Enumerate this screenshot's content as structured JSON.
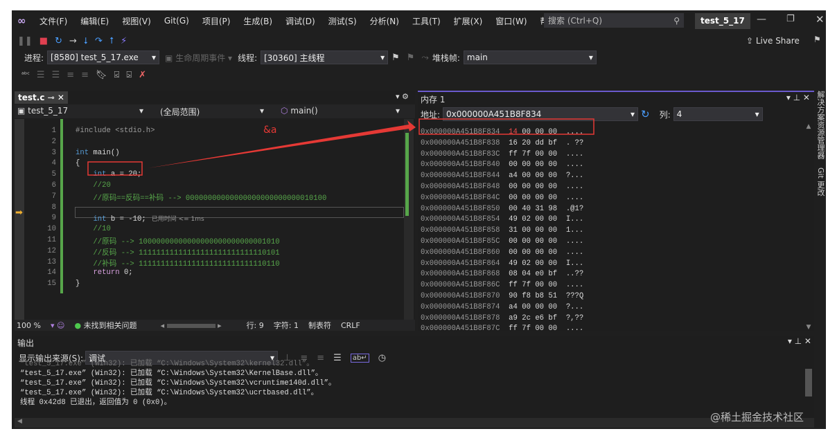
{
  "menu": {
    "items": [
      "文件(F)",
      "编辑(E)",
      "视图(V)",
      "Git(G)",
      "项目(P)",
      "生成(B)",
      "调试(D)",
      "测试(S)",
      "分析(N)",
      "工具(T)",
      "扩展(X)",
      "窗口(W)",
      "帮助(H)"
    ],
    "search_placeholder": "搜索 (Ctrl+Q)",
    "solution": "test_5_17",
    "live_share": "Live Share"
  },
  "debug_toolbar": {
    "process_label": "进程:",
    "process": "[8580] test_5_17.exe",
    "lifecycle": "生命周期事件",
    "thread_label": "线程:",
    "thread": "[30360] 主线程",
    "stack_label": "堆栈帧:",
    "stack": "main"
  },
  "editor": {
    "tab": "test.c",
    "project": "test_5_17",
    "scope": "(全局范围)",
    "function": "main()",
    "lines": [
      [
        {
          "t": "#include <stdio.h>",
          "c": "pp"
        }
      ],
      [],
      [
        {
          "t": "int",
          "c": "kw"
        },
        {
          "t": " main()",
          "c": "tx"
        }
      ],
      [
        {
          "t": "{",
          "c": "tx"
        }
      ],
      [
        {
          "t": "    "
        },
        {
          "t": "int",
          "c": "kw"
        },
        {
          "t": " a = 20;",
          "c": "tx"
        }
      ],
      [
        {
          "t": "    //20",
          "c": "cm"
        }
      ],
      [
        {
          "t": "    //原码==反码==补码 --> 00000000000000000000000000010100",
          "c": "cm"
        }
      ],
      [],
      [
        {
          "t": "    "
        },
        {
          "t": "int",
          "c": "kw"
        },
        {
          "t": " b = -10;",
          "c": "tx"
        }
      ],
      [
        {
          "t": "    //10",
          "c": "cm"
        }
      ],
      [
        {
          "t": "    //原码 --> 10000000000000000000000000001010",
          "c": "cm"
        }
      ],
      [
        {
          "t": "    //反码 --> 11111111111111111111111111110101",
          "c": "cm"
        }
      ],
      [
        {
          "t": "    //补码 --> 11111111111111111111111111110110",
          "c": "cm"
        }
      ],
      [
        {
          "t": "    "
        },
        {
          "t": "return",
          "c": "kw2"
        },
        {
          "t": " 0;",
          "c": "tx"
        }
      ],
      [
        {
          "t": "}",
          "c": "tx"
        }
      ]
    ],
    "elapsed": "已用时间 <= 1ms",
    "current_line": 9,
    "status": {
      "zoom": "100 %",
      "issues": "未找到相关问题",
      "line": "行: 9",
      "char": "字符: 1",
      "tabs": "制表符",
      "eol": "CRLF"
    }
  },
  "annotation": {
    "label": "&a",
    "color": "#e53935"
  },
  "memory": {
    "title": "内存 1",
    "address_label": "地址:",
    "address": "0x000000A451B8F834",
    "columns_label": "列:",
    "columns": "4",
    "rows": [
      {
        "addr": "0x000000A451B8F834",
        "bytes": [
          "14",
          "00",
          "00",
          "00"
        ],
        "ascii": "...."
      },
      {
        "addr": "0x000000A451B8F838",
        "bytes": [
          "16",
          "20",
          "dd",
          "bf"
        ],
        "ascii": ". ??"
      },
      {
        "addr": "0x000000A451B8F83C",
        "bytes": [
          "ff",
          "7f",
          "00",
          "00"
        ],
        "ascii": "...."
      },
      {
        "addr": "0x000000A451B8F840",
        "bytes": [
          "00",
          "00",
          "00",
          "00"
        ],
        "ascii": "...."
      },
      {
        "addr": "0x000000A451B8F844",
        "bytes": [
          "a4",
          "00",
          "00",
          "00"
        ],
        "ascii": "?..."
      },
      {
        "addr": "0x000000A451B8F848",
        "bytes": [
          "00",
          "00",
          "00",
          "00"
        ],
        "ascii": "...."
      },
      {
        "addr": "0x000000A451B8F84C",
        "bytes": [
          "00",
          "00",
          "00",
          "00"
        ],
        "ascii": "...."
      },
      {
        "addr": "0x000000A451B8F850",
        "bytes": [
          "00",
          "40",
          "31",
          "98"
        ],
        "ascii": ".@1?"
      },
      {
        "addr": "0x000000A451B8F854",
        "bytes": [
          "49",
          "02",
          "00",
          "00"
        ],
        "ascii": "I..."
      },
      {
        "addr": "0x000000A451B8F858",
        "bytes": [
          "31",
          "00",
          "00",
          "00"
        ],
        "ascii": "1..."
      },
      {
        "addr": "0x000000A451B8F85C",
        "bytes": [
          "00",
          "00",
          "00",
          "00"
        ],
        "ascii": "...."
      },
      {
        "addr": "0x000000A451B8F860",
        "bytes": [
          "00",
          "00",
          "00",
          "00"
        ],
        "ascii": "...."
      },
      {
        "addr": "0x000000A451B8F864",
        "bytes": [
          "49",
          "02",
          "00",
          "00"
        ],
        "ascii": "I..."
      },
      {
        "addr": "0x000000A451B8F868",
        "bytes": [
          "08",
          "04",
          "e0",
          "bf"
        ],
        "ascii": "..??"
      },
      {
        "addr": "0x000000A451B8F86C",
        "bytes": [
          "ff",
          "7f",
          "00",
          "00"
        ],
        "ascii": "...."
      },
      {
        "addr": "0x000000A451B8F870",
        "bytes": [
          "90",
          "f8",
          "b8",
          "51"
        ],
        "ascii": "???Q"
      },
      {
        "addr": "0x000000A451B8F874",
        "bytes": [
          "a4",
          "00",
          "00",
          "00"
        ],
        "ascii": "?..."
      },
      {
        "addr": "0x000000A451B8F878",
        "bytes": [
          "a9",
          "2c",
          "e6",
          "bf"
        ],
        "ascii": "?,??"
      },
      {
        "addr": "0x000000A451B8F87C",
        "bytes": [
          "ff",
          "7f",
          "00",
          "00"
        ],
        "ascii": "...."
      }
    ]
  },
  "side_tabs": [
    "解决方案资源管理器",
    "Git 更改"
  ],
  "output": {
    "title": "输出",
    "source_label": "显示输出来源(S):",
    "source": "调试",
    "lines": [
      "“test_5_17.exe” (Win32): 已加载 “C:\\Windows\\System32\\kernel32.dll”。",
      "“test_5_17.exe” (Win32): 已加载 “C:\\Windows\\System32\\KernelBase.dll”。",
      "“test_5_17.exe” (Win32): 已加载 “C:\\Windows\\System32\\vcruntime140d.dll”。",
      "“test_5_17.exe” (Win32): 已加载 “C:\\Windows\\System32\\ucrtbased.dll”。",
      "线程 0x42d8 已退出，返回值为 0 (0x0)。"
    ]
  },
  "watermark": "@稀土掘金技术社区"
}
